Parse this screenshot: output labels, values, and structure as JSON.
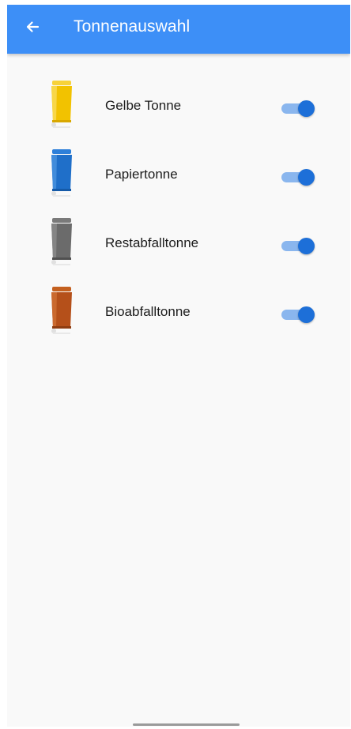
{
  "appbar": {
    "title": "Tonnenauswahl",
    "back_icon": "arrow-left-icon",
    "color": "#3d8ff7"
  },
  "bins": [
    {
      "id": "gelbe",
      "label": "Gelbe Tonne",
      "color": "#f2c200",
      "icon": "yellow-bin-icon",
      "enabled": true
    },
    {
      "id": "papier",
      "label": "Papiertonne",
      "color": "#1f6fc9",
      "icon": "blue-bin-icon",
      "enabled": true
    },
    {
      "id": "rest",
      "label": "Restabfalltonne",
      "color": "#6b6b6b",
      "icon": "grey-bin-icon",
      "enabled": true
    },
    {
      "id": "bio",
      "label": "Bioabfalltonne",
      "color": "#b5501a",
      "icon": "brown-bin-icon",
      "enabled": true
    }
  ],
  "switch_colors": {
    "track": "#8ab6ee",
    "thumb": "#1d6fd8"
  }
}
